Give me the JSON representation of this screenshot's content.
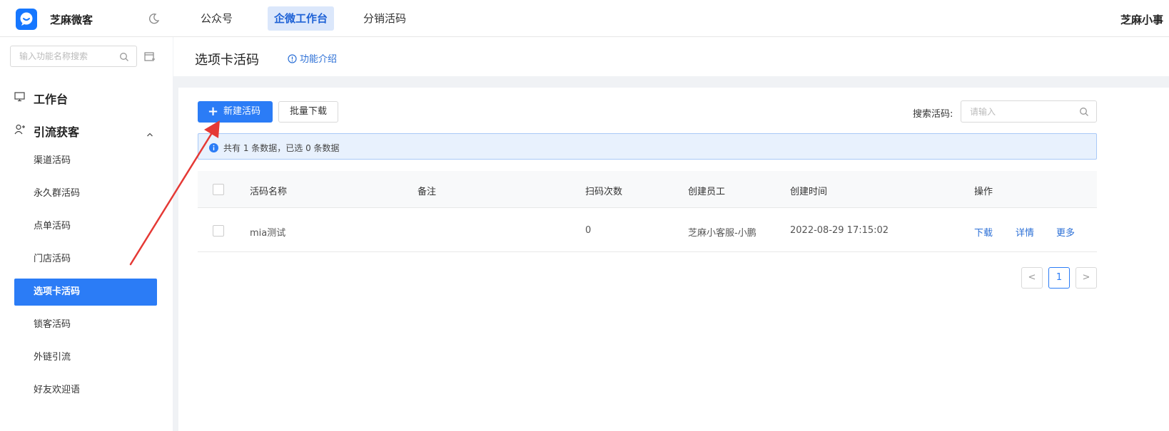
{
  "app": {
    "brand": "芝麻微客",
    "user": "芝麻小事"
  },
  "top_nav": [
    {
      "label": "公众号"
    },
    {
      "label": "企微工作台"
    },
    {
      "label": "分销活码"
    }
  ],
  "sidebar": {
    "search_placeholder": "输入功能名称搜索",
    "sections": [
      {
        "label": "工作台"
      },
      {
        "label": "引流获客"
      }
    ],
    "items": [
      {
        "label": "渠道活码"
      },
      {
        "label": "永久群活码"
      },
      {
        "label": "点单活码"
      },
      {
        "label": "门店活码"
      },
      {
        "label": "选项卡活码"
      },
      {
        "label": "锁客活码"
      },
      {
        "label": "外链引流"
      },
      {
        "label": "好友欢迎语"
      }
    ]
  },
  "page": {
    "title": "选项卡活码",
    "intro_link": "功能介绍"
  },
  "toolbar": {
    "new_button": "新建活码",
    "batch_download": "批量下载",
    "search_label": "搜索活码:",
    "search_placeholder": "请输入"
  },
  "alert": {
    "text": "共有 1 条数据，已选 0 条数据"
  },
  "table": {
    "columns": [
      "活码名称",
      "备注",
      "扫码次数",
      "创建员工",
      "创建时间",
      "操作"
    ],
    "rows": [
      {
        "name": "mia测试",
        "remark": "",
        "scans": "0",
        "staff": "芝麻小客服-小鹏",
        "created": "2022-08-29 17:15:02",
        "actions": [
          "下载",
          "详情",
          "更多"
        ]
      }
    ]
  },
  "pagination": {
    "prev": "<",
    "current": "1",
    "next": ">"
  },
  "colors": {
    "primary": "#2b7cf6",
    "link": "#2b6fd6",
    "annotation": "#e53935"
  }
}
